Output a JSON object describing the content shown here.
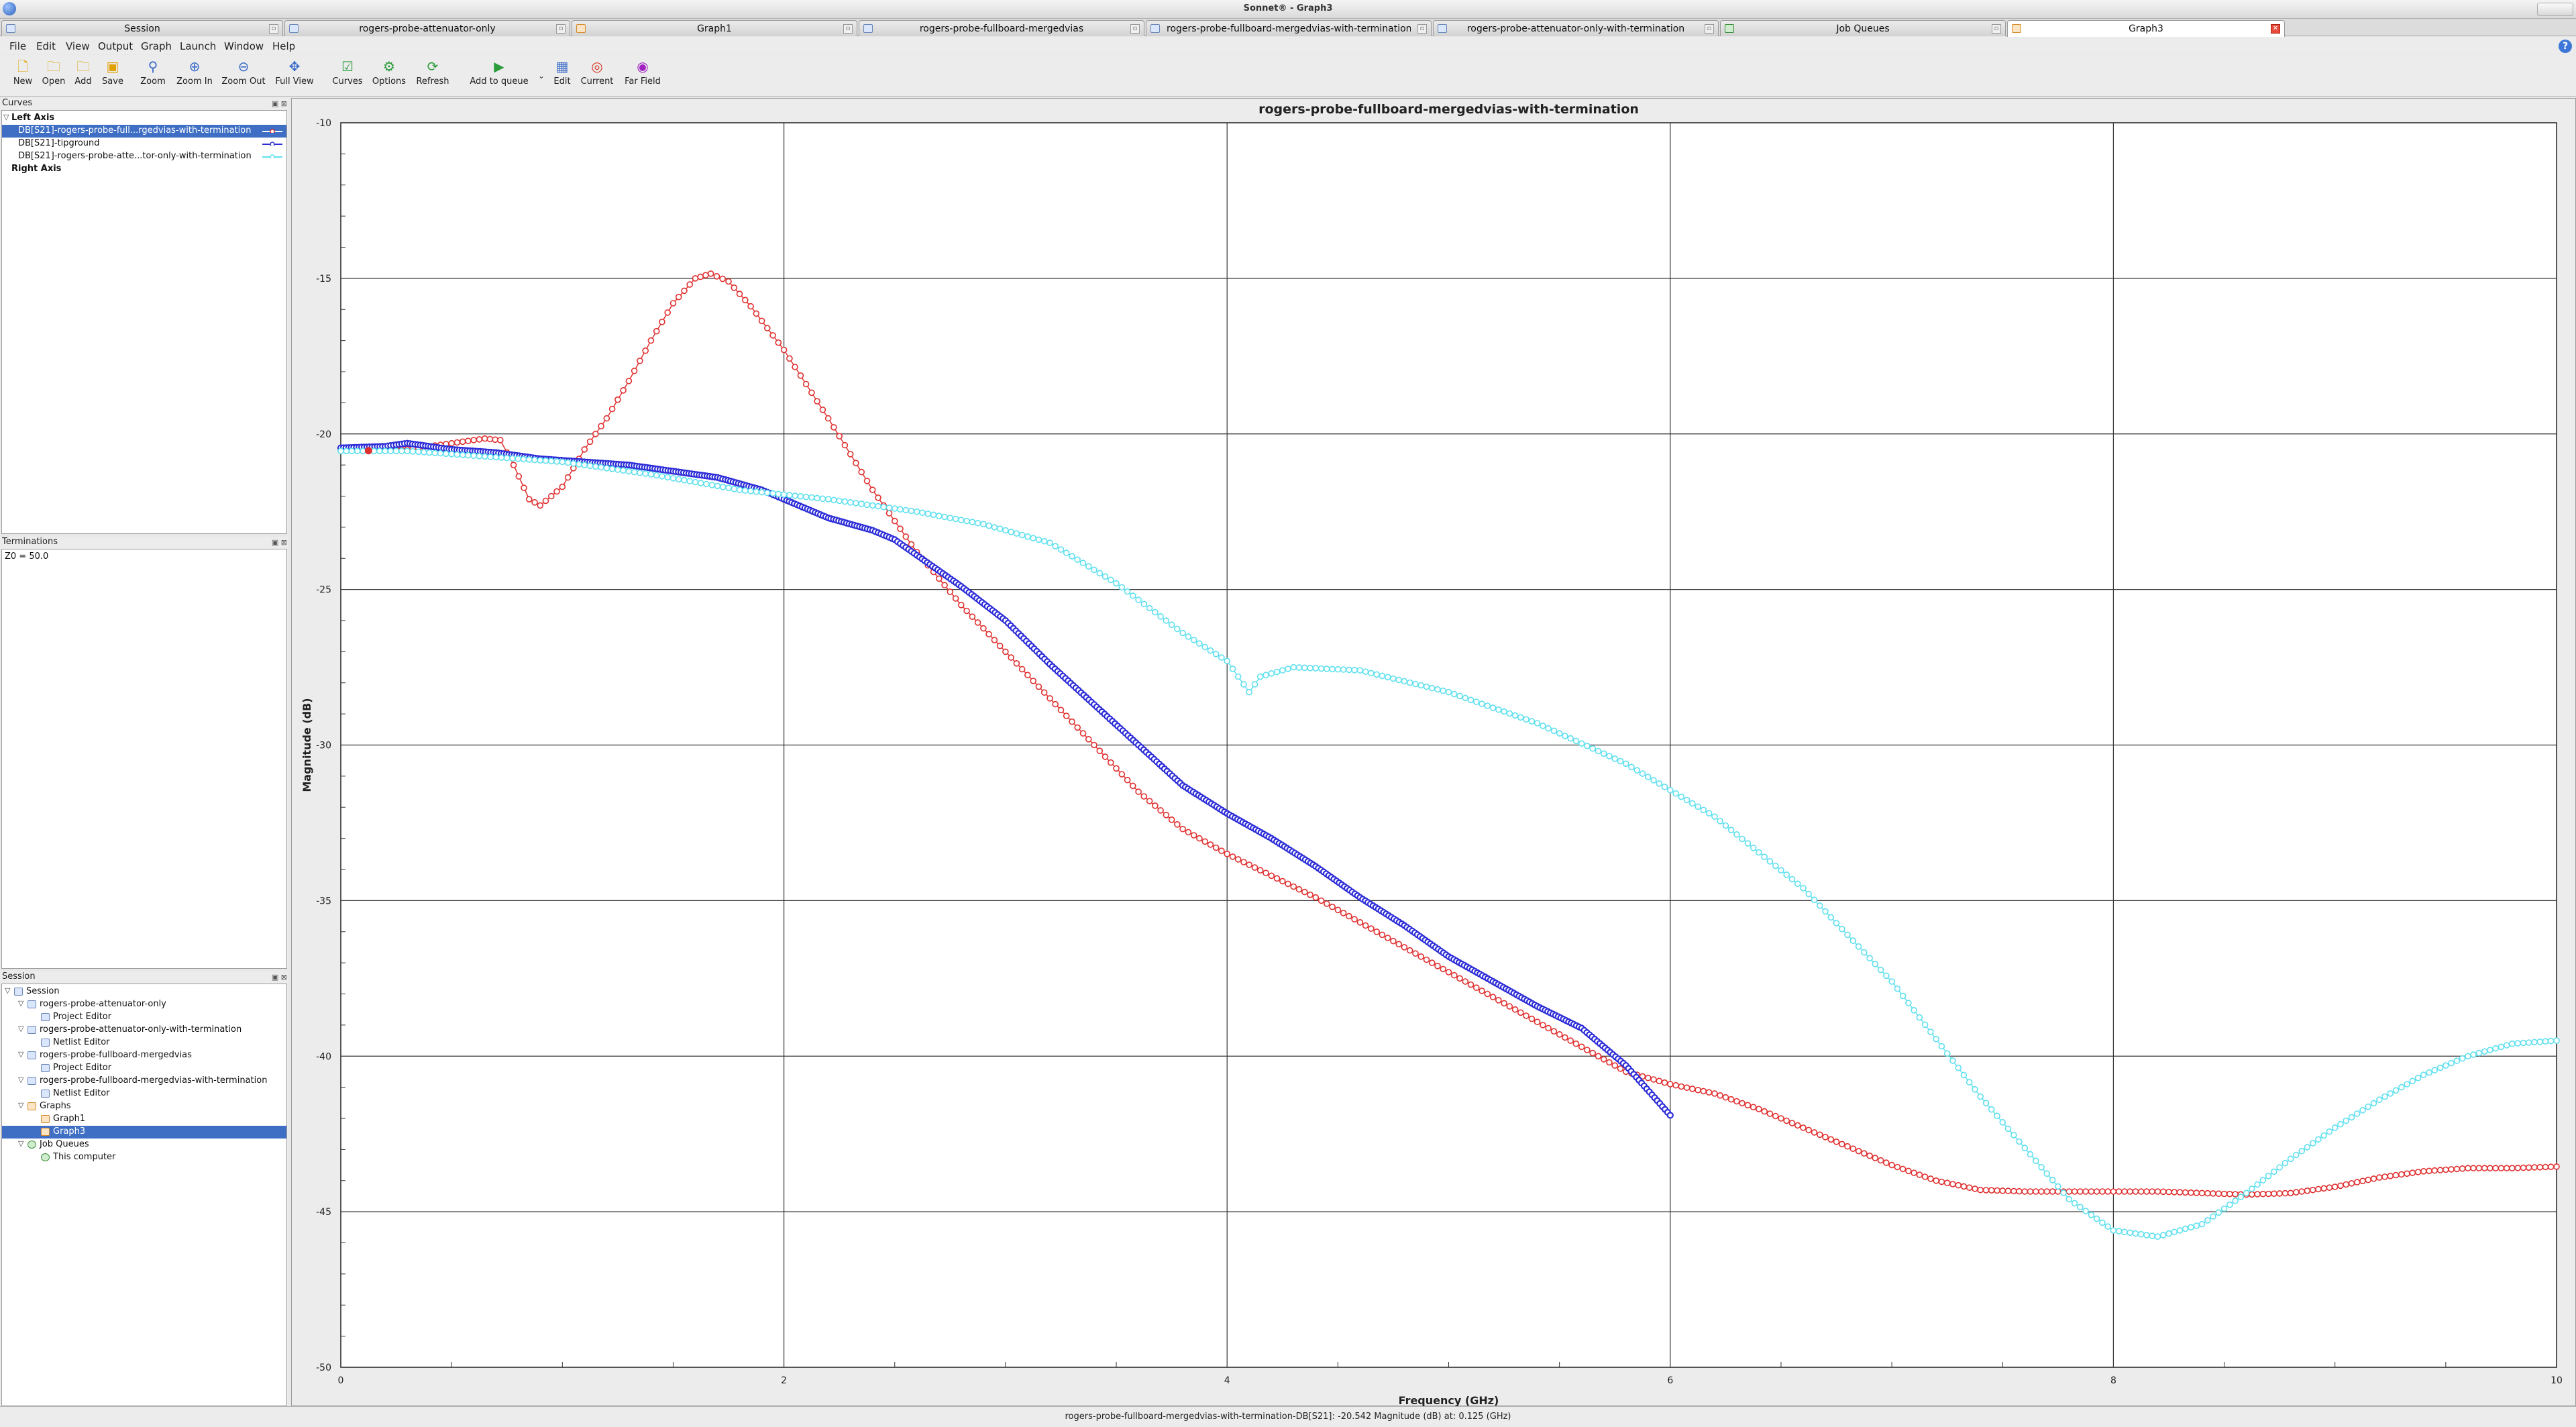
{
  "window": {
    "title": "Sonnet® - Graph3"
  },
  "tabs": [
    {
      "label": "Session",
      "icon": "session-icon"
    },
    {
      "label": "rogers-probe-attenuator-only",
      "icon": "project-icon"
    },
    {
      "label": "Graph1",
      "icon": "graph-icon"
    },
    {
      "label": "rogers-probe-fullboard-mergedvias",
      "icon": "project-icon"
    },
    {
      "label": "rogers-probe-fullboard-mergedvias-with-termination",
      "icon": "netlist-icon"
    },
    {
      "label": "rogers-probe-attenuator-only-with-termination",
      "icon": "netlist-icon"
    },
    {
      "label": "Job Queues",
      "icon": "job-queue-icon"
    },
    {
      "label": "Graph3",
      "icon": "graph-icon"
    }
  ],
  "menu": [
    "File",
    "Edit",
    "View",
    "Output",
    "Graph",
    "Launch",
    "Window",
    "Help"
  ],
  "toolbar": {
    "new": "New",
    "open": "Open",
    "add": "Add",
    "save": "Save",
    "zoom": "Zoom",
    "zoom_in": "Zoom In",
    "zoom_out": "Zoom Out",
    "full_view": "Full View",
    "curves": "Curves",
    "options": "Options",
    "refresh": "Refresh",
    "add_to_queue": "Add to queue",
    "edit": "Edit",
    "current": "Current",
    "far_field": "Far Field"
  },
  "curves_panel": {
    "title": "Curves",
    "left_axis": "Left Axis",
    "items": [
      {
        "label": "DB[S21]-rogers-probe-full...rgedvias-with-termination",
        "color": "#e03030",
        "selected": true
      },
      {
        "label": "DB[S21]-tipground",
        "color": "#2c2cd8",
        "selected": false
      },
      {
        "label": "DB[S21]-rogers-probe-atte...tor-only-with-termination",
        "color": "#5fe0ee",
        "selected": false
      }
    ],
    "right_axis": "Right Axis"
  },
  "terminations_panel": {
    "title": "Terminations",
    "value": "Z0 = 50.0"
  },
  "session_panel": {
    "title": "Session",
    "nodes": [
      {
        "label": "Session",
        "indent": 0,
        "expander": "▽",
        "icon": "session-icon",
        "selected": false
      },
      {
        "label": "rogers-probe-attenuator-only",
        "indent": 1,
        "expander": "▽",
        "icon": "project-icon",
        "selected": false
      },
      {
        "label": "Project Editor",
        "indent": 2,
        "expander": "",
        "icon": "editor-icon",
        "selected": false
      },
      {
        "label": "rogers-probe-attenuator-only-with-termination",
        "indent": 1,
        "expander": "▽",
        "icon": "netlist-icon",
        "selected": false
      },
      {
        "label": "Netlist Editor",
        "indent": 2,
        "expander": "",
        "icon": "netlist-icon",
        "selected": false
      },
      {
        "label": "rogers-probe-fullboard-mergedvias",
        "indent": 1,
        "expander": "▽",
        "icon": "project-icon",
        "selected": false
      },
      {
        "label": "Project Editor",
        "indent": 2,
        "expander": "",
        "icon": "editor-icon",
        "selected": false
      },
      {
        "label": "rogers-probe-fullboard-mergedvias-with-termination",
        "indent": 1,
        "expander": "▽",
        "icon": "netlist-icon",
        "selected": false
      },
      {
        "label": "Netlist Editor",
        "indent": 2,
        "expander": "",
        "icon": "netlist-icon",
        "selected": false
      },
      {
        "label": "Graphs",
        "indent": 1,
        "expander": "▽",
        "icon": "graph-folder-icon",
        "selected": false
      },
      {
        "label": "Graph1",
        "indent": 2,
        "expander": "",
        "icon": "graph-icon",
        "selected": false
      },
      {
        "label": "Graph3",
        "indent": 2,
        "expander": "",
        "icon": "graph-icon",
        "selected": true
      },
      {
        "label": "Job Queues",
        "indent": 1,
        "expander": "▽",
        "icon": "job-queue-icon",
        "selected": false
      },
      {
        "label": "This computer",
        "indent": 2,
        "expander": "",
        "icon": "computer-check-icon",
        "selected": false
      }
    ]
  },
  "status_bar": "rogers-probe-fullboard-mergedvias-with-termination-DB[S21]: -20.542 Magnitude (dB) at: 0.125 (GHz)",
  "chart_data": {
    "type": "line",
    "title": "rogers-probe-fullboard-mergedvias-with-termination",
    "xlabel": "Frequency (GHz)",
    "ylabel": "Magnitude (dB)",
    "xlim": [
      0,
      10
    ],
    "ylim": [
      -50,
      -10
    ],
    "x_ticks": [
      0,
      2,
      4,
      6,
      8,
      10
    ],
    "y_ticks": [
      -10,
      -15,
      -20,
      -25,
      -30,
      -35,
      -40,
      -45,
      -50
    ],
    "grid": true,
    "series": [
      {
        "name": "DB[S21]-rogers-probe-full...rgedvias-with-termination",
        "color": "#e03030",
        "marker": "open-circle",
        "points": [
          [
            0,
            -20.5
          ],
          [
            0.125,
            -20.54
          ],
          [
            0.3,
            -20.5
          ],
          [
            0.5,
            -20.3
          ],
          [
            0.65,
            -20.15
          ],
          [
            0.72,
            -20.2
          ],
          [
            0.78,
            -21.0
          ],
          [
            0.85,
            -22.1
          ],
          [
            0.9,
            -22.3
          ],
          [
            1.0,
            -21.7
          ],
          [
            1.1,
            -20.5
          ],
          [
            1.2,
            -19.5
          ],
          [
            1.3,
            -18.3
          ],
          [
            1.4,
            -17.0
          ],
          [
            1.5,
            -15.8
          ],
          [
            1.6,
            -15.0
          ],
          [
            1.67,
            -14.85
          ],
          [
            1.75,
            -15.1
          ],
          [
            1.85,
            -15.9
          ],
          [
            2.0,
            -17.3
          ],
          [
            2.2,
            -19.5
          ],
          [
            2.4,
            -21.8
          ],
          [
            2.6,
            -23.8
          ],
          [
            2.8,
            -25.5
          ],
          [
            3.0,
            -27.0
          ],
          [
            3.2,
            -28.5
          ],
          [
            3.4,
            -30.0
          ],
          [
            3.6,
            -31.5
          ],
          [
            3.8,
            -32.7
          ],
          [
            4.0,
            -33.5
          ],
          [
            4.2,
            -34.2
          ],
          [
            4.4,
            -34.9
          ],
          [
            4.6,
            -35.7
          ],
          [
            4.8,
            -36.5
          ],
          [
            5.0,
            -37.3
          ],
          [
            5.2,
            -38.1
          ],
          [
            5.4,
            -38.9
          ],
          [
            5.6,
            -39.7
          ],
          [
            5.8,
            -40.5
          ],
          [
            6.0,
            -40.9
          ],
          [
            6.2,
            -41.2
          ],
          [
            6.4,
            -41.7
          ],
          [
            6.6,
            -42.3
          ],
          [
            6.8,
            -42.9
          ],
          [
            7.0,
            -43.5
          ],
          [
            7.2,
            -44.0
          ],
          [
            7.4,
            -44.3
          ],
          [
            7.6,
            -44.35
          ],
          [
            7.8,
            -44.35
          ],
          [
            8.0,
            -44.35
          ],
          [
            8.2,
            -44.35
          ],
          [
            8.4,
            -44.4
          ],
          [
            8.6,
            -44.45
          ],
          [
            8.8,
            -44.4
          ],
          [
            9.0,
            -44.2
          ],
          [
            9.2,
            -43.9
          ],
          [
            9.4,
            -43.7
          ],
          [
            9.6,
            -43.6
          ],
          [
            9.8,
            -43.6
          ],
          [
            10.0,
            -43.55
          ]
        ]
      },
      {
        "name": "DB[S21]-tipground",
        "color": "#2c2cd8",
        "marker": "filled-circle",
        "points": [
          [
            0,
            -20.45
          ],
          [
            0.2,
            -20.4
          ],
          [
            0.3,
            -20.3
          ],
          [
            0.5,
            -20.5
          ],
          [
            0.7,
            -20.6
          ],
          [
            0.9,
            -20.8
          ],
          [
            1.1,
            -20.9
          ],
          [
            1.3,
            -21.0
          ],
          [
            1.5,
            -21.2
          ],
          [
            1.7,
            -21.4
          ],
          [
            1.9,
            -21.8
          ],
          [
            2.0,
            -22.1
          ],
          [
            2.2,
            -22.7
          ],
          [
            2.4,
            -23.1
          ],
          [
            2.5,
            -23.4
          ],
          [
            2.6,
            -23.9
          ],
          [
            2.8,
            -24.9
          ],
          [
            3.0,
            -26.0
          ],
          [
            3.2,
            -27.4
          ],
          [
            3.4,
            -28.7
          ],
          [
            3.6,
            -30.0
          ],
          [
            3.8,
            -31.3
          ],
          [
            4.0,
            -32.2
          ],
          [
            4.2,
            -33.0
          ],
          [
            4.4,
            -33.9
          ],
          [
            4.6,
            -34.9
          ],
          [
            4.8,
            -35.8
          ],
          [
            5.0,
            -36.8
          ],
          [
            5.2,
            -37.6
          ],
          [
            5.4,
            -38.4
          ],
          [
            5.6,
            -39.1
          ],
          [
            5.8,
            -40.3
          ],
          [
            6.0,
            -41.9
          ]
        ]
      },
      {
        "name": "DB[S21]-rogers-probe-atte...tor-only-with-termination",
        "color": "#5fe0ee",
        "marker": "open-circle",
        "points": [
          [
            0,
            -20.55
          ],
          [
            0.3,
            -20.55
          ],
          [
            0.6,
            -20.7
          ],
          [
            1.0,
            -20.9
          ],
          [
            1.4,
            -21.3
          ],
          [
            1.8,
            -21.8
          ],
          [
            2.2,
            -22.1
          ],
          [
            2.6,
            -22.5
          ],
          [
            2.9,
            -22.9
          ],
          [
            3.2,
            -23.5
          ],
          [
            3.5,
            -24.8
          ],
          [
            3.8,
            -26.4
          ],
          [
            4.0,
            -27.3
          ],
          [
            4.05,
            -27.8
          ],
          [
            4.1,
            -28.3
          ],
          [
            4.15,
            -27.8
          ],
          [
            4.3,
            -27.5
          ],
          [
            4.6,
            -27.6
          ],
          [
            5.0,
            -28.3
          ],
          [
            5.4,
            -29.3
          ],
          [
            5.8,
            -30.6
          ],
          [
            6.2,
            -32.3
          ],
          [
            6.6,
            -34.6
          ],
          [
            7.0,
            -37.6
          ],
          [
            7.4,
            -41.3
          ],
          [
            7.8,
            -44.6
          ],
          [
            8.0,
            -45.6
          ],
          [
            8.2,
            -45.8
          ],
          [
            8.4,
            -45.4
          ],
          [
            8.6,
            -44.4
          ],
          [
            8.8,
            -43.3
          ],
          [
            9.0,
            -42.3
          ],
          [
            9.2,
            -41.4
          ],
          [
            9.4,
            -40.6
          ],
          [
            9.6,
            -40.0
          ],
          [
            9.8,
            -39.6
          ],
          [
            10.0,
            -39.5
          ]
        ]
      }
    ]
  }
}
